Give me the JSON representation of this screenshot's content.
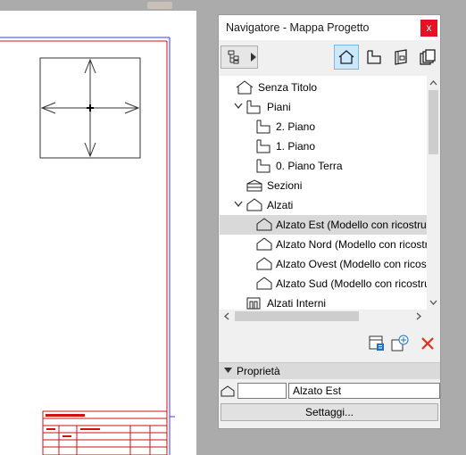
{
  "window": {
    "title": "Navigatore - Mappa Progetto",
    "close_glyph": "x"
  },
  "toolbar": {
    "map_dropdown_icon": "tree-icon",
    "views": [
      {
        "name": "project-map-icon",
        "active": true
      },
      {
        "name": "view-map-icon",
        "active": false
      },
      {
        "name": "layout-book-icon",
        "active": false
      },
      {
        "name": "publisher-sets-icon",
        "active": false
      }
    ]
  },
  "tree": {
    "items": [
      {
        "label": "Senza Titolo",
        "icon": "project-house-icon",
        "level": 0,
        "expander": "none"
      },
      {
        "label": "Piani",
        "icon": "stories-icon",
        "level": 1,
        "expander": "expanded"
      },
      {
        "label": "2. Piano",
        "icon": "story-icon",
        "level": 2,
        "expander": "none"
      },
      {
        "label": "1. Piano",
        "icon": "story-icon",
        "level": 2,
        "expander": "none"
      },
      {
        "label": "0. Piano Terra",
        "icon": "story-icon",
        "level": 2,
        "expander": "none"
      },
      {
        "label": "Sezioni",
        "icon": "section-icon",
        "level": 1,
        "expander": "none"
      },
      {
        "label": "Alzati",
        "icon": "elevation-icon",
        "level": 1,
        "expander": "expanded"
      },
      {
        "label": "Alzato Est (Modello con ricostruzione)",
        "icon": "elevation-icon",
        "level": 2,
        "expander": "none",
        "selected": true
      },
      {
        "label": "Alzato Nord (Modello con ricostruzione)",
        "icon": "elevation-icon",
        "level": 2,
        "expander": "none"
      },
      {
        "label": "Alzato Ovest (Modello con ricostruzione)",
        "icon": "elevation-icon",
        "level": 2,
        "expander": "none"
      },
      {
        "label": "Alzato Sud (Modello con ricostruzione)",
        "icon": "elevation-icon",
        "level": 2,
        "expander": "none"
      },
      {
        "label": "Alzati Interni",
        "icon": "interior-elevation-icon",
        "level": 1,
        "expander": "none"
      }
    ]
  },
  "actions": [
    {
      "name": "open-settings-icon"
    },
    {
      "name": "new-view-icon"
    },
    {
      "name": "delete-icon",
      "color": "#e0301e"
    }
  ],
  "properties": {
    "header": "Proprietà",
    "id_value": "",
    "name_value": "Alzato Est",
    "settings_label": "Settaggi..."
  },
  "colors": {
    "selection": "#d9d9d9",
    "active_tool": "#cce8ff",
    "close": "#e81123",
    "drawing_line": "#d01010"
  }
}
